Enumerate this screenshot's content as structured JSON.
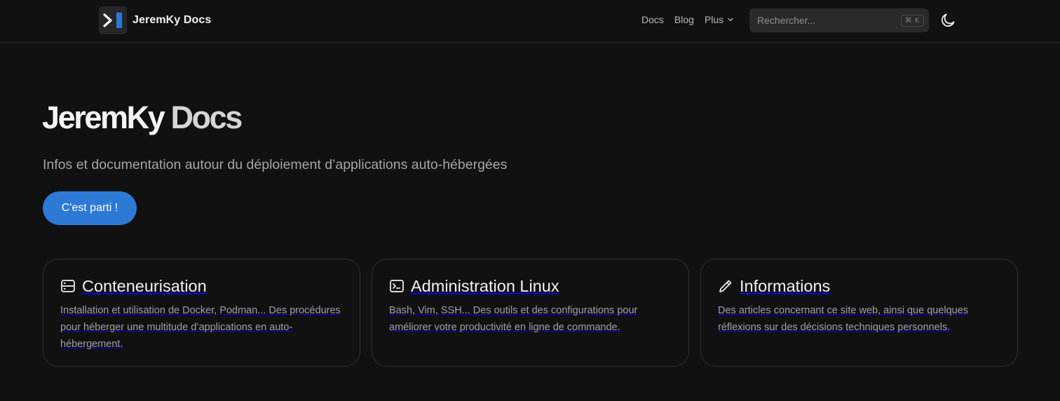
{
  "brand": {
    "title": "JeremKy Docs",
    "logo": "terminal-prompt-logo"
  },
  "nav": {
    "links": [
      {
        "label": "Docs"
      },
      {
        "label": "Blog"
      },
      {
        "label": "Plus",
        "icon": "chevron-down-icon"
      }
    ],
    "search": {
      "placeholder": "Rechercher...",
      "shortcut": "⌘ K",
      "icon": "none"
    },
    "theme_toggle": {
      "icon": "moon-icon"
    }
  },
  "hero": {
    "title_part1": "JeremKy",
    "title_part2": "Docs",
    "subtitle": "Infos et documentation autour du déploiement d’applications auto-hébergées",
    "cta_label": "C'est parti !"
  },
  "cards": [
    {
      "icon": "server-icon",
      "title": "Conteneurisation",
      "description": "Installation et utilisation de Docker, Podman... Des procédures pour héberger une multitude d’applications en auto-hébergement."
    },
    {
      "icon": "terminal-icon",
      "title": "Administration Linux",
      "description": "Bash, Vim, SSH... Des outils et des configurations pour améliorer votre productivité en ligne de commande."
    },
    {
      "icon": "pencil-icon",
      "title": "Informations",
      "description": "Des articles concernant ce site web, ainsi que quelques réflexions sur des décisions techniques personnels."
    }
  ],
  "colors": {
    "background": "#111112",
    "accent": "#2d7ad6",
    "card_border": "#2f2f33",
    "text_muted": "#a5a5ab"
  }
}
